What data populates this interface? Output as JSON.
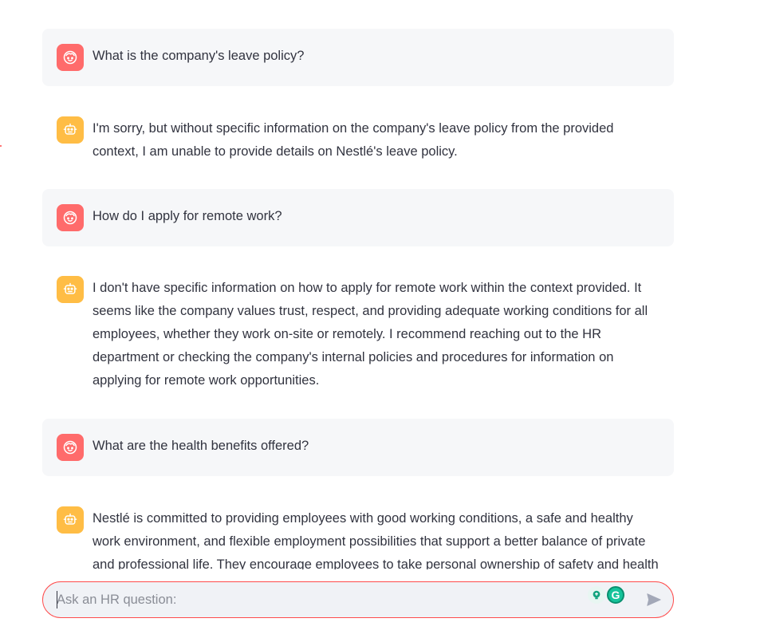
{
  "messages": [
    {
      "role": "user",
      "avatar_icon": "user-face-icon",
      "text": "What is the company's leave policy?"
    },
    {
      "role": "assistant",
      "avatar_icon": "robot-icon",
      "text": "I'm sorry, but without specific information on the company's leave policy from the provided context, I am unable to provide details on Nestlé's leave policy."
    },
    {
      "role": "user",
      "avatar_icon": "user-face-icon",
      "text": "How do I apply for remote work?"
    },
    {
      "role": "assistant",
      "avatar_icon": "robot-icon",
      "text": "I don't have specific information on how to apply for remote work within the context provided. It seems like the company values trust, respect, and providing adequate working conditions for all employees, whether they work on-site or remotely. I recommend reaching out to the HR department or checking the company's internal policies and procedures for information on applying for remote work opportunities."
    },
    {
      "role": "user",
      "avatar_icon": "user-face-icon",
      "text": "What are the health benefits offered?"
    },
    {
      "role": "assistant",
      "avatar_icon": "robot-icon",
      "text": "Nestlé is committed to providing employees with good working conditions, a safe and healthy work environment, and flexible employment possibilities that support a better balance of private and professional life. They encourage employees to take personal ownership of safety and health"
    }
  ],
  "chat_input": {
    "placeholder": "Ask an HR question:",
    "value": "",
    "send_icon": "send-arrow-icon",
    "extension_icons": [
      "lightbulb-icon",
      "grammarly-icon"
    ],
    "extension_g_label": "G"
  },
  "colors": {
    "user_avatar": "#ff6b6b",
    "assistant_avatar": "#ffbd45",
    "user_bubble": "#f6f7f9",
    "input_border": "#ff4b4b",
    "input_bg": "#f0f2f6",
    "text": "#31333f"
  }
}
